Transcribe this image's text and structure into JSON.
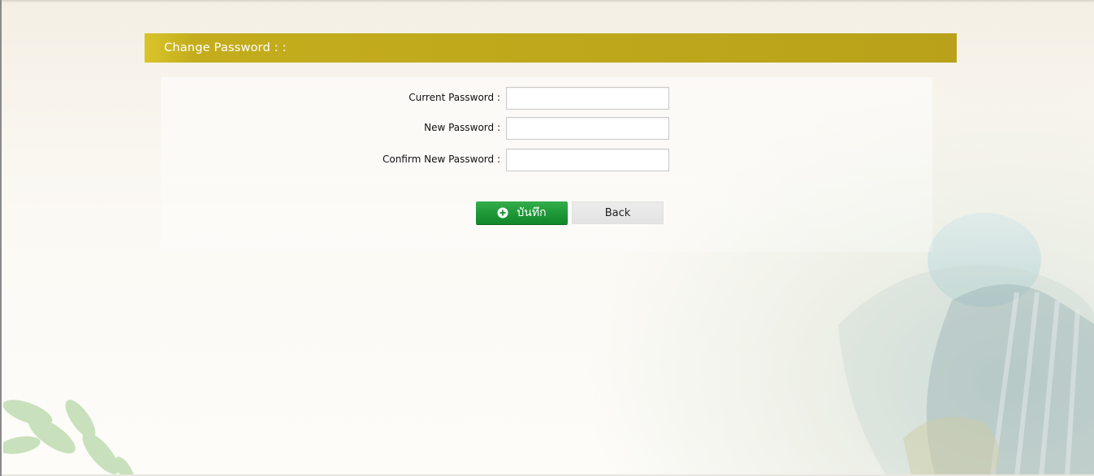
{
  "header": {
    "title": "Change Password : :"
  },
  "form": {
    "fields": [
      {
        "label": "Current Password :",
        "value": "",
        "placeholder": ""
      },
      {
        "label": "New Password :",
        "value": "",
        "placeholder": ""
      },
      {
        "label": "Confirm New Password :",
        "value": "",
        "placeholder": ""
      }
    ]
  },
  "actions": {
    "save_label": "บันทึก",
    "save_icon": "plus-circle-icon",
    "back_label": "Back"
  },
  "colors": {
    "header_bar": "#bfa81c",
    "save_button": "#1f9a38",
    "back_button": "#e6e6e6"
  }
}
